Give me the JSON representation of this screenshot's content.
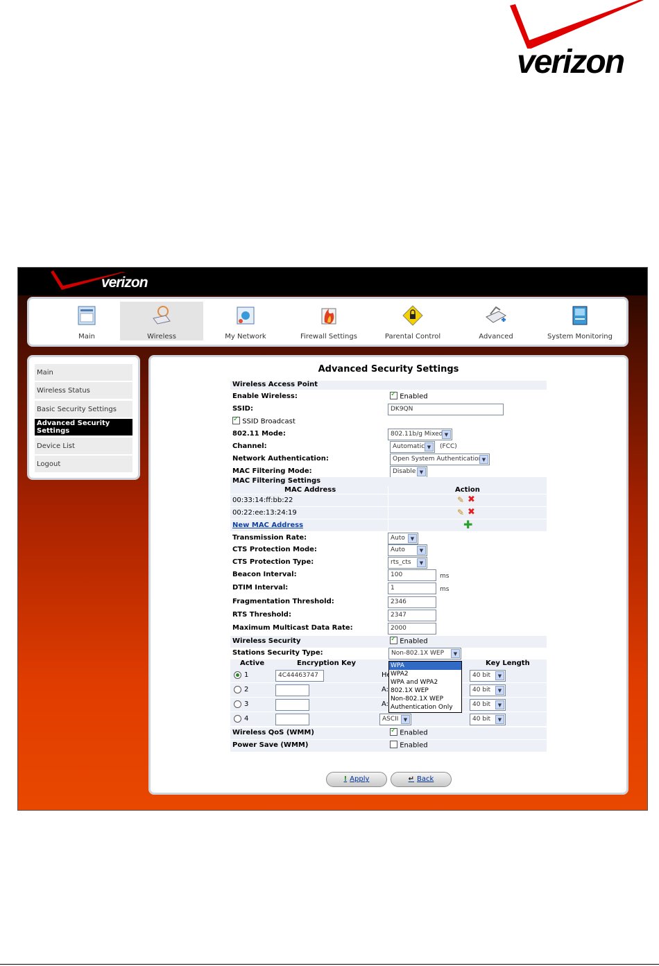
{
  "brand": {
    "logo_text": "verizon",
    "logo_small": "verizon"
  },
  "nav": [
    {
      "label": "Main",
      "icon": "main-icon"
    },
    {
      "label": "Wireless",
      "icon": "wireless-icon"
    },
    {
      "label": "My Network",
      "icon": "my-network-icon"
    },
    {
      "label": "Firewall Settings",
      "icon": "firewall-icon"
    },
    {
      "label": "Parental Control",
      "icon": "parental-control-icon"
    },
    {
      "label": "Advanced",
      "icon": "advanced-icon"
    },
    {
      "label": "System Monitoring",
      "icon": "system-monitoring-icon"
    }
  ],
  "sidebar": [
    {
      "label": "Main"
    },
    {
      "label": "Wireless Status"
    },
    {
      "label": "Basic Security Settings"
    },
    {
      "label": "Advanced Security Settings"
    },
    {
      "label": "Device List"
    },
    {
      "label": "Logout"
    }
  ],
  "page": {
    "title": "Advanced Security Settings",
    "section_wap": "Wireless Access Point",
    "enable_wireless_label": "Enable Wireless:",
    "enabled_text": "Enabled",
    "ssid_label": "SSID:",
    "ssid_value": "DK9QN",
    "ssid_broadcast_label": "SSID Broadcast",
    "mode_label": "802.11 Mode:",
    "mode_value": "802.11b/g Mixed",
    "channel_label": "Channel:",
    "channel_value": "Automatic",
    "channel_region": "(FCC)",
    "netauth_label": "Network Authentication:",
    "netauth_value": "Open System Authentication",
    "macfilter_mode_label": "MAC Filtering Mode:",
    "macfilter_mode_value": "Disable",
    "macfilter_settings": "MAC Filtering Settings",
    "mac_col": "MAC Address",
    "action_col": "Action",
    "macs": [
      "00:33:14:ff:bb:22",
      "00:22:ee:13:24:19"
    ],
    "new_mac": "New MAC Address",
    "txrate_label": "Transmission Rate:",
    "txrate_value": "Auto",
    "cts_mode_label": "CTS Protection Mode:",
    "cts_mode_value": "Auto",
    "cts_type_label": "CTS Protection Type:",
    "cts_type_value": "rts_cts",
    "beacon_label": "Beacon Interval:",
    "beacon_value": "100",
    "dtim_label": "DTIM Interval:",
    "dtim_value": "1",
    "ms": "ms",
    "frag_label": "Fragmentation Threshold:",
    "frag_value": "2346",
    "rts_label": "RTS Threshold:",
    "rts_value": "2347",
    "mcast_label": "Maximum Multicast Data Rate:",
    "mcast_value": "2000",
    "wsec_label": "Wireless Security",
    "sst_label": "Stations Security Type:",
    "sst_value": "Non-802.1X WEP",
    "active_col": "Active",
    "enckey_col": "Encryption Key",
    "keylen_col": "Key Length",
    "keys": [
      {
        "num": "1",
        "key": "4C44463747",
        "type": "He",
        "len": "40 bit"
      },
      {
        "num": "2",
        "key": "",
        "type": "A:",
        "len": "40 bit"
      },
      {
        "num": "3",
        "key": "",
        "type": "A:",
        "len": "40 bit"
      },
      {
        "num": "4",
        "key": "",
        "type": "ASCII",
        "len": "40 bit"
      }
    ],
    "qos_label": "Wireless QoS (WMM)",
    "psave_label": "Power Save (WMM)",
    "dropdown_options": [
      "WPA",
      "WPA2",
      "WPA and WPA2",
      "802.1X WEP",
      "Non-802.1X WEP",
      "Authentication Only"
    ],
    "apply": "Apply",
    "back": "Back"
  }
}
